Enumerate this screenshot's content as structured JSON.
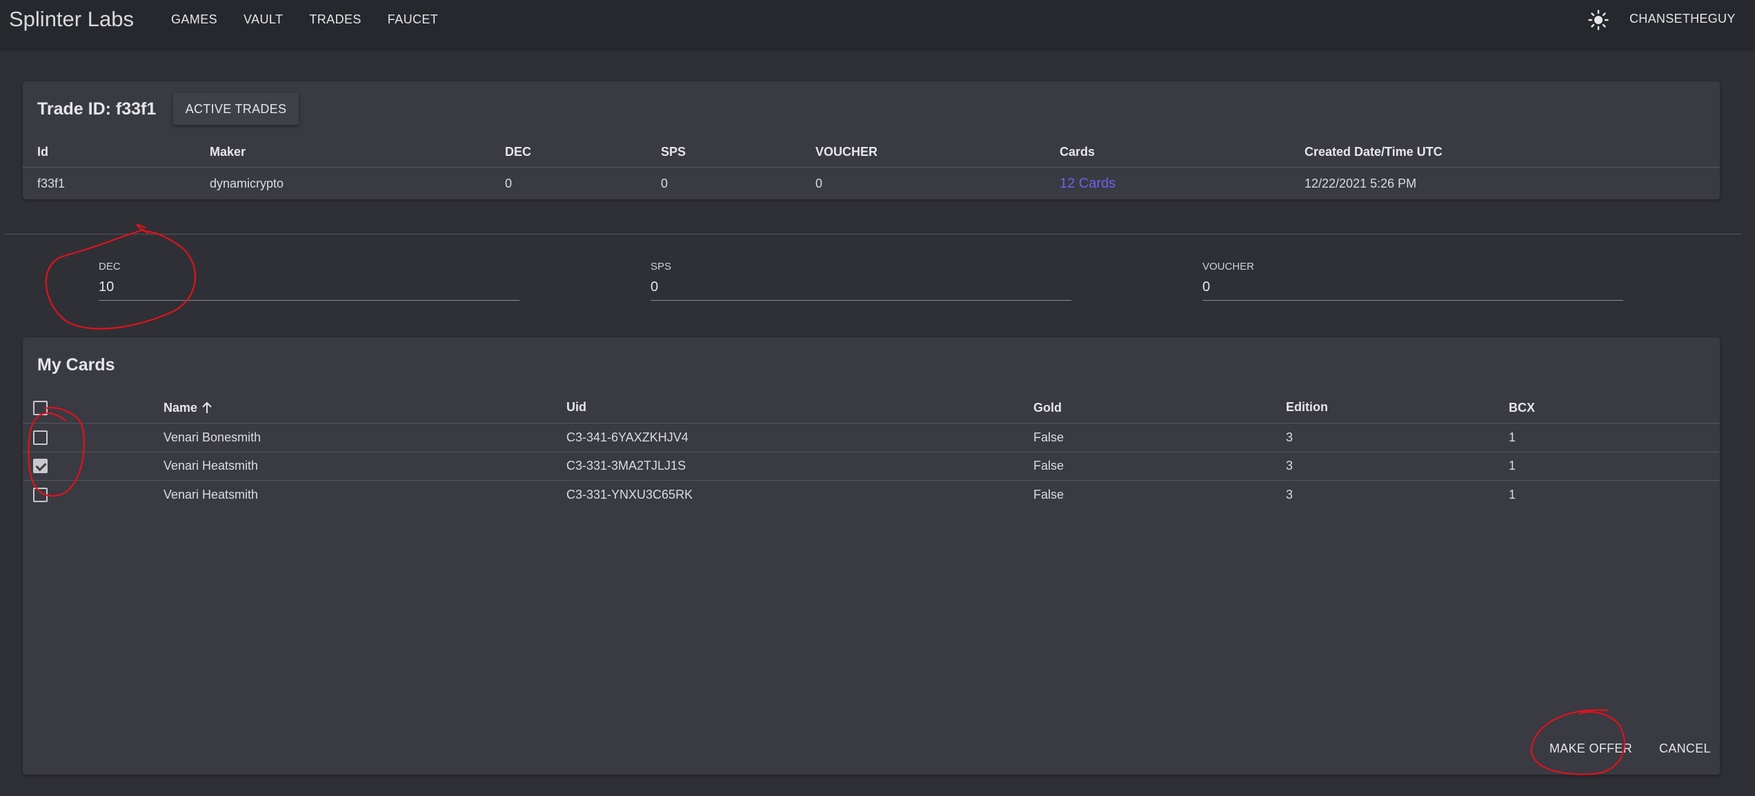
{
  "app": {
    "brand": "Splinter Labs",
    "nav": [
      "GAMES",
      "VAULT",
      "TRADES",
      "FAUCET"
    ],
    "user": "CHANSETHEGUY",
    "accent": "#6f63e8",
    "annotation_color": "#e0121b"
  },
  "trade": {
    "title": "Trade ID: f33f1",
    "active_trades_label": "ACTIVE TRADES",
    "columns": [
      "Id",
      "Maker",
      "DEC",
      "SPS",
      "VOUCHER",
      "Cards",
      "Created Date/Time UTC"
    ],
    "row": {
      "id": "f33f1",
      "maker": "dynamicrypto",
      "dec": "0",
      "sps": "0",
      "voucher": "0",
      "cards": "12 Cards",
      "created": "12/22/2021 5:26 PM"
    }
  },
  "offer": {
    "dec": {
      "label": "DEC",
      "value": "10"
    },
    "sps": {
      "label": "SPS",
      "value": "0"
    },
    "voucher": {
      "label": "VOUCHER",
      "value": "0"
    }
  },
  "my_cards": {
    "title": "My Cards",
    "columns": [
      "Name",
      "Uid",
      "Gold",
      "Edition",
      "BCX"
    ],
    "rows": [
      {
        "checked": false,
        "name": "Venari Bonesmith",
        "uid": "C3-341-6YAXZKHJV4",
        "gold": "False",
        "edition": "3",
        "bcx": "1"
      },
      {
        "checked": true,
        "name": "Venari Heatsmith",
        "uid": "C3-331-3MA2TJLJ1S",
        "gold": "False",
        "edition": "3",
        "bcx": "1"
      },
      {
        "checked": false,
        "name": "Venari Heatsmith",
        "uid": "C3-331-YNXU3C65RK",
        "gold": "False",
        "edition": "3",
        "bcx": "1"
      }
    ],
    "make_offer_label": "MAKE OFFER",
    "cancel_label": "CANCEL"
  }
}
